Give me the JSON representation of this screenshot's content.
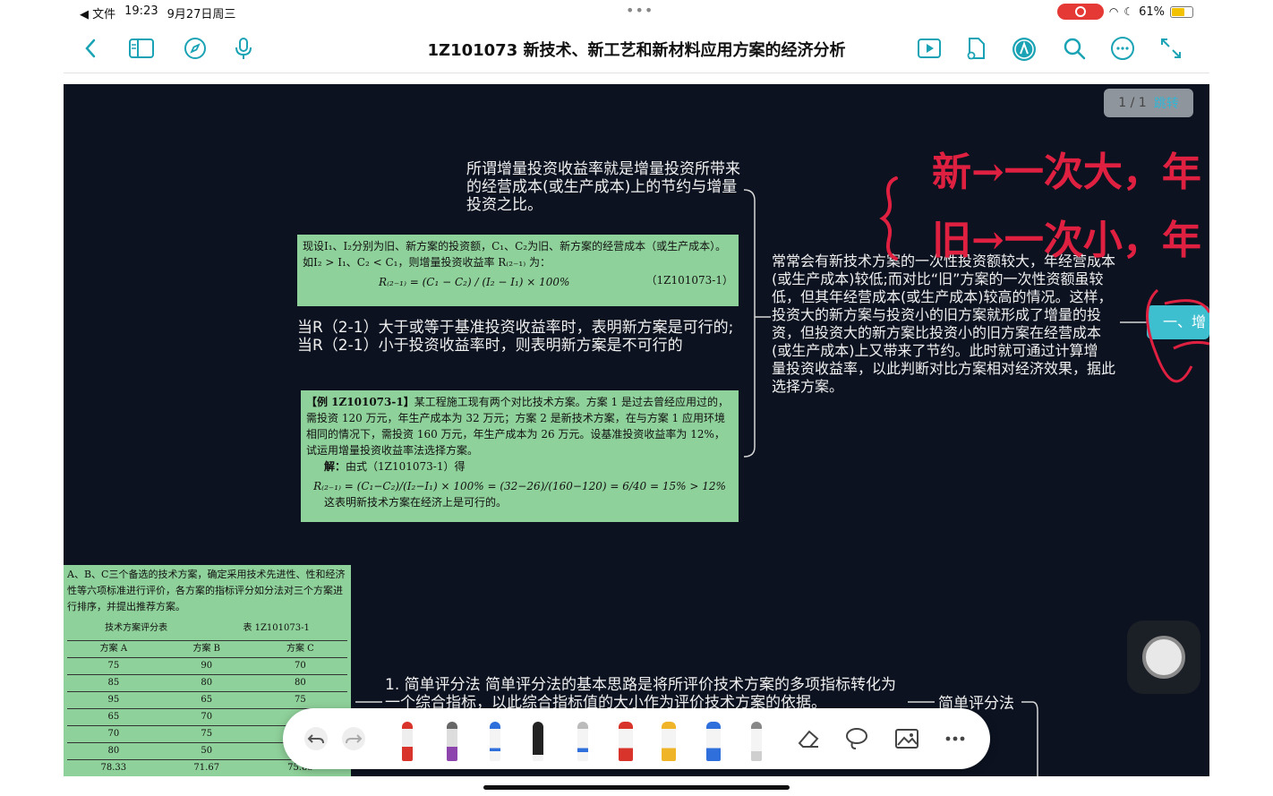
{
  "status": {
    "carrier": "◀ 文件",
    "time": "19:23",
    "date": "9月27日周三",
    "battery": "61%",
    "dots": "•••"
  },
  "toolbar": {
    "title": "1Z101073 新技术、新工艺和新材料应用方案的经济分析",
    "icons": [
      "back-icon",
      "sidebar-icon",
      "compass-icon",
      "microphone-icon",
      "play-icon",
      "document-icon",
      "pen-mode-icon",
      "search-icon",
      "more-icon",
      "expand-icon"
    ]
  },
  "page_indicator": {
    "page": "1 / 1",
    "jump": "跳转"
  },
  "mindmap": {
    "def_text": "所谓增量投资收益率就是增量投资所带来的经营成本(或生产成本)上的节约与增量 投资之比。",
    "green1_line1": "现设I₁、I₂分别为旧、新方案的投资额，C₁、C₂为旧、新方案的经营成本（或生产成本）。",
    "green1_line2": "如I₂ > I₁、C₂ < C₁，则增量投资收益率 R₍₂₋₁₎ 为：",
    "green1_formula": "R₍₂₋₁₎ = (C₁ − C₂) / (I₂ − I₁) × 100%",
    "green1_code": "（1Z101073-1）",
    "judge_text": "当R（2-1）大于或等于基准投资收益率时，表明新方案是可行的;当R（2-1）小于投资收益率时，则表明新方案是不可行的",
    "example_title": "【例 1Z101073-1】",
    "example_body": "某工程施工现有两个对比技术方案。方案 1 是过去曾经应用过的，需投资 120 万元，年生产成本为 32 万元；方案 2 是新技术方案，在与方案 1 应用环境相同的情况下，需投资 160 万元，年生产成本为 26 万元。设基准投资收益率为 12%，试运用增量投资收益率法选择方案。",
    "example_solution_label": "解：",
    "example_solution_intro": "由式（1Z101073-1）得",
    "example_formula": "R₍₂₋₁₎ = (C₁−C₂)/(I₂−I₁) × 100% = (32−26)/(160−120) = 6/40 = 15% > 12%",
    "example_conclusion": "这表明新技术方案在经济上是可行的。",
    "right_text": "常常会有新技术方案的一次性投资额较大，年经营成本(或生产成本)较低;而对比“旧”方案的一次性资额虽较低，但其年经营成本(或生产成本)较高的情况。这样，投资大的新方案与投资小的旧方案就形成了增量的投资，但投资大的新方案比投资小的旧方案在经营成本(或生产成本)上又带来了节约。此时就可通过计算增 量投资收益率，以此判断对比方案相对经济效果，据此选择方案。",
    "tag_node": "一、增",
    "simple_text": "1. 简单评分法 简单评分法的基本思路是将所评价技术方案的多项指标转化为一个综合指标，以此综合指标值的大小作为评价技术方案的依据。",
    "simple_label": "简单评分法"
  },
  "score_image": {
    "intro": "A、B、C三个备选的技术方案，确定采用技术先进性、性和经济性等六项标准进行评价，各方案的指标评分如分法对三个方案进行排序，并提出推荐方案。",
    "table_title": "技术方案评分表",
    "table_code": "表 1Z101073-1",
    "headers": [
      "",
      "方案 A",
      "方案 B",
      "方案 C"
    ],
    "rows": [
      [
        "",
        "75",
        "90",
        "70"
      ],
      [
        "",
        "85",
        "80",
        "80"
      ],
      [
        "",
        "95",
        "65",
        "75"
      ],
      [
        "",
        "65",
        "70",
        ""
      ],
      [
        "",
        "70",
        "75",
        ""
      ],
      [
        "",
        "80",
        "50",
        ""
      ],
      [
        "",
        "78.33",
        "71.67",
        "75.83"
      ]
    ]
  },
  "handwriting": {
    "line1": "新→一次大，年",
    "line2": "旧→一次小，年"
  },
  "pen_bar": {
    "tools": [
      "undo-icon",
      "redo-icon",
      "fountain-pen-red",
      "fountain-pen-purple",
      "ballpoint-blue",
      "ballpoint-black",
      "ballpoint-blue-2",
      "marker-red",
      "highlighter-yellow",
      "highlighter-blue",
      "pencil-icon",
      "eraser-icon",
      "lasso-icon",
      "image-icon",
      "more-icon"
    ],
    "colors": {
      "pen_red": "#d9342b",
      "pen_purple": "#8e44ad",
      "blue": "#2f6fdc",
      "black": "#222222",
      "yellow": "#f0b429",
      "accent": "#1aa3b5"
    }
  }
}
